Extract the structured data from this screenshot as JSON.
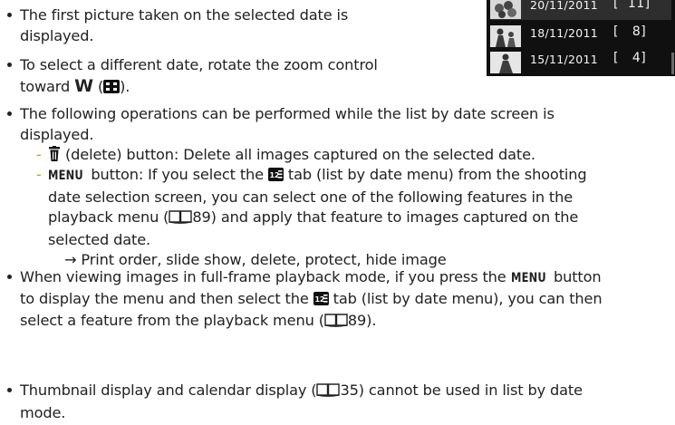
{
  "lcd": {
    "rows": [
      {
        "date": "20/11/2011",
        "count": "[  11]",
        "icon": "flowers-thumbnail-icon"
      },
      {
        "date": "18/11/2011",
        "count": "[   8]",
        "icon": "people-thumbnail-icon"
      },
      {
        "date": "15/11/2011",
        "count": "[   4]",
        "icon": "person-thumbnail-icon"
      }
    ]
  },
  "bullets": {
    "b1": "The first picture taken on the selected date is displayed.",
    "b1_l1": "The first picture taken on the selected date is",
    "b1_l2": "displayed.",
    "b2_l1": "To select a different date, rotate the zoom control",
    "b2_l2_a": "toward",
    "b2_l2_w": "W",
    "b2_l2_b": ").",
    "b3_l1": "The following operations can be performed while the list by date screen is",
    "b3_l2": "displayed.",
    "sub1": " (delete) button: Delete all images captured on the selected date.",
    "sub2_menu": "MENU",
    "sub2_l1_a": " button: If you select the ",
    "sub2_l1_b": " tab (list by date menu) from the shooting",
    "sub2_l2": "date selection screen, you can select one of the following features in the",
    "sub2_l3_a": "playback menu (",
    "sub2_l3_b": "89) and apply that feature to images captured on the",
    "sub2_l4": "selected date.",
    "arrow": "→",
    "arrow_text": "Print order, slide show, delete, protect, hide image",
    "b4_l1_a": "When viewing images in full-frame playback mode, if you press the ",
    "b4_menu": "MENU",
    "b4_l1_b": " button",
    "b4_l2_a": "to display the menu and then select the ",
    "b4_l2_b": " tab (list by date menu), you can then",
    "b4_l3_a": "select a feature from the playback menu (",
    "b4_l3_b": "89).",
    "b5_l1_a": "Thumbnail display and calendar display (",
    "b5_l1_b": "35) cannot be used in list by date",
    "b5_l2": "mode."
  },
  "icons": {
    "trash": "trash-icon",
    "thumbnail_grid": "thumbnail-grid-icon",
    "list_by_date_tab": "list-by-date-tab-icon",
    "book_reference": "book-reference-icon"
  }
}
